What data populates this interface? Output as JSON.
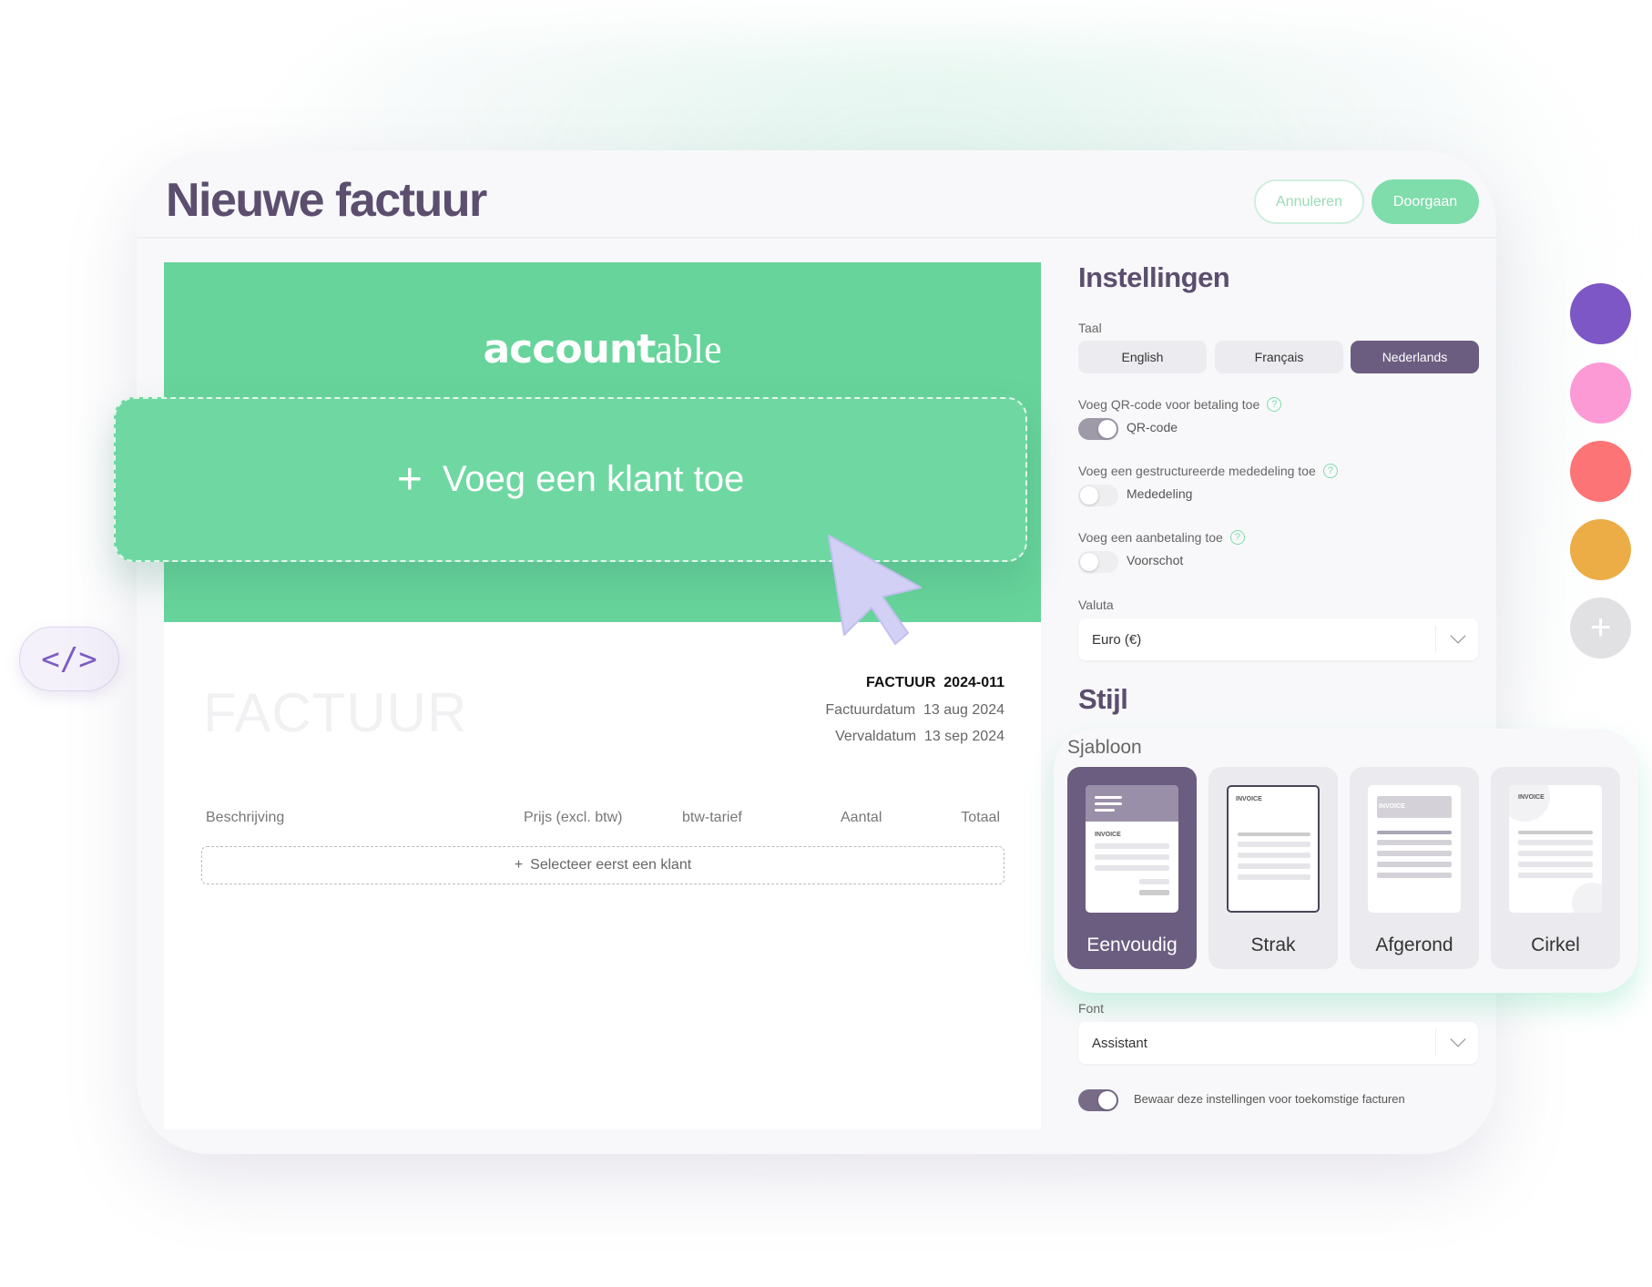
{
  "header": {
    "title": "Nieuwe factuur",
    "cancel_label": "Annuleren",
    "continue_label": "Doorgaan"
  },
  "invoice": {
    "logo_main": "account",
    "logo_tail": "able",
    "add_client": "Voeg een klant toe",
    "watermark": "FACTUUR",
    "number_label": "FACTUUR",
    "number": "2024-011",
    "date_label": "Factuurdatum",
    "date": "13 aug 2024",
    "due_label": "Vervaldatum",
    "due": "13 sep 2024",
    "columns": [
      "Beschrijving",
      "Prijs (excl. btw)",
      "btw-tarief",
      "Aantal",
      "Totaal"
    ],
    "select_client": "Selecteer eerst een klant"
  },
  "settings": {
    "title": "Instellingen",
    "language_label": "Taal",
    "languages": [
      "English",
      "Français",
      "Nederlands"
    ],
    "selected_language": "Nederlands",
    "qr": {
      "label": "Voeg QR-code voor betaling toe",
      "toggle": "QR-code",
      "on": true
    },
    "structured": {
      "label": "Voeg een gestructureerde mededeling toe",
      "toggle": "Mededeling",
      "on": false
    },
    "deposit": {
      "label": "Voeg een aanbetaling toe",
      "toggle": "Voorschot",
      "on": false
    },
    "currency_label": "Valuta",
    "currency": "Euro (€)"
  },
  "style": {
    "title": "Stijl",
    "template_label": "Sjabloon",
    "templates": [
      "Eenvoudig",
      "Strak",
      "Afgerond",
      "Cirkel"
    ],
    "selected_template": "Eenvoudig",
    "invoice_text": "INVOICE",
    "font_label": "Font",
    "font": "Assistant",
    "save_label": "Bewaar deze instellingen voor toekomstige facturen",
    "save_on": true
  },
  "colors": {
    "brand_green": "#67d49b",
    "accent_purple": "#6b5d80",
    "swatches": [
      "#7d57c6",
      "#fc9ad6",
      "#fd7476",
      "#ecad47"
    ]
  },
  "side": {
    "code_icon": "</>",
    "add_color": "+"
  }
}
